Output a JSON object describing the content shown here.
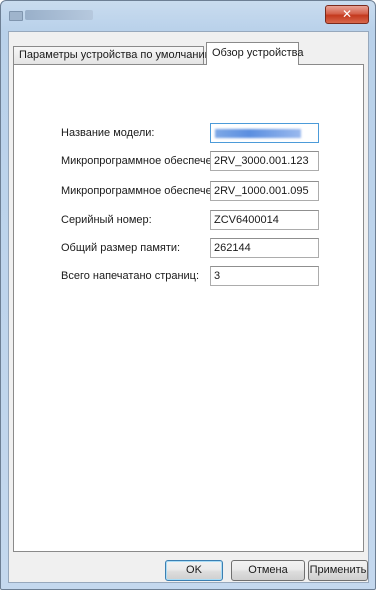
{
  "window": {
    "close_glyph": "✕"
  },
  "tabs": [
    {
      "label": "Параметры устройства по умолчанию",
      "active": false
    },
    {
      "label": "Обзор устройства",
      "active": true
    }
  ],
  "fields": [
    {
      "label": "Название модели:",
      "value": "",
      "redacted": true
    },
    {
      "label": "Микропрограммное обеспечение:",
      "value": "2RV_3000.001.123"
    },
    {
      "label": "Микропрограммное обеспечение:",
      "value": "2RV_1000.001.095"
    },
    {
      "label": "Серийный номер:",
      "value": "ZCV6400014"
    },
    {
      "label": "Общий размер памяти:",
      "value": "262144"
    },
    {
      "label": "Всего напечатано страниц:",
      "value": "3"
    }
  ],
  "buttons": {
    "ok": "OK",
    "cancel": "Отмена",
    "apply": "Применить"
  }
}
